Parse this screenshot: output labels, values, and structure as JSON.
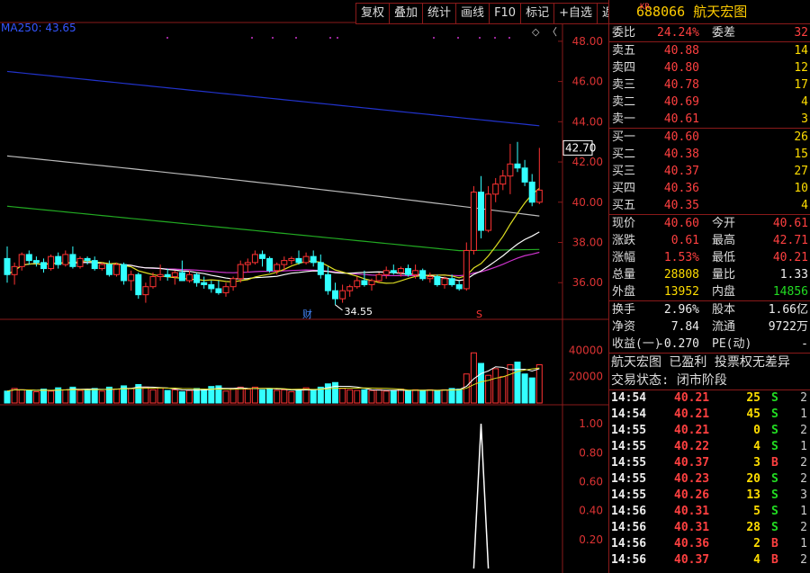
{
  "toolbar": {
    "buttons": [
      "复权",
      "叠加",
      "统计",
      "画线",
      "F10",
      "标记",
      "+自选",
      "返回"
    ]
  },
  "chart": {
    "ma_label": "MA250: 43.65",
    "price_axis": [
      "48.00",
      "46.00",
      "44.00",
      "42.00",
      "40.00",
      "38.00",
      "36.00"
    ],
    "current_price_tag": "42.70",
    "min_price_label": "34.55",
    "volume_axis": [
      "40000",
      "20000"
    ],
    "indicator_axis": [
      "1.00",
      "0.80",
      "0.60",
      "0.40",
      "0.20"
    ],
    "markers": {
      "cai": "财",
      "s": "S",
      "diamond": "◇",
      "chevron": "〈"
    }
  },
  "chart_data": {
    "type": "candlestick",
    "price_range": [
      34.4,
      48.8
    ],
    "candles": [
      [
        37.2,
        37.8,
        36.0,
        36.4
      ],
      [
        36.4,
        37.0,
        35.9,
        36.8
      ],
      [
        36.8,
        37.5,
        36.6,
        37.4
      ],
      [
        37.4,
        37.6,
        36.9,
        37.1
      ],
      [
        37.1,
        37.3,
        36.8,
        37.0
      ],
      [
        37.0,
        37.2,
        36.5,
        36.7
      ],
      [
        36.7,
        37.4,
        36.6,
        37.3
      ],
      [
        37.3,
        37.5,
        36.7,
        36.9
      ],
      [
        36.9,
        37.6,
        36.8,
        37.4
      ],
      [
        37.4,
        37.8,
        36.7,
        36.8
      ],
      [
        36.8,
        37.3,
        36.7,
        37.2
      ],
      [
        37.2,
        37.3,
        36.9,
        37.1
      ],
      [
        37.1,
        37.3,
        36.6,
        36.7
      ],
      [
        36.7,
        37.0,
        36.6,
        36.9
      ],
      [
        36.9,
        37.1,
        36.3,
        36.4
      ],
      [
        36.4,
        37.0,
        36.3,
        36.9
      ],
      [
        36.9,
        37.0,
        35.9,
        36.1
      ],
      [
        36.1,
        36.6,
        35.6,
        36.4
      ],
      [
        36.4,
        36.5,
        35.2,
        35.4
      ],
      [
        35.4,
        36.0,
        35.0,
        35.8
      ],
      [
        35.8,
        36.5,
        35.7,
        36.3
      ],
      [
        36.3,
        36.9,
        36.1,
        36.4
      ],
      [
        36.4,
        36.7,
        36.1,
        36.3
      ],
      [
        36.3,
        36.6,
        35.9,
        36.5
      ],
      [
        36.5,
        37.1,
        36.4,
        36.1
      ],
      [
        36.1,
        36.6,
        36.0,
        36.4
      ],
      [
        36.4,
        36.5,
        35.8,
        36.0
      ],
      [
        36.0,
        36.3,
        35.7,
        35.9
      ],
      [
        35.9,
        36.1,
        35.5,
        35.7
      ],
      [
        35.7,
        36.1,
        35.4,
        35.5
      ],
      [
        35.5,
        36.0,
        35.3,
        35.8
      ],
      [
        35.8,
        36.3,
        35.6,
        36.2
      ],
      [
        36.2,
        37.1,
        36.0,
        36.9
      ],
      [
        36.9,
        37.2,
        36.5,
        37.0
      ],
      [
        37.0,
        37.6,
        36.9,
        37.4
      ],
      [
        37.4,
        37.6,
        36.8,
        37.2
      ],
      [
        37.2,
        37.3,
        36.5,
        36.6
      ],
      [
        36.6,
        37.0,
        36.4,
        36.9
      ],
      [
        36.9,
        37.3,
        36.6,
        37.1
      ],
      [
        37.1,
        37.3,
        36.9,
        37.2
      ],
      [
        37.2,
        37.6,
        36.9,
        37.0
      ],
      [
        37.0,
        37.5,
        36.9,
        37.3
      ],
      [
        37.3,
        37.6,
        36.8,
        37.0
      ],
      [
        37.0,
        37.4,
        36.2,
        36.4
      ],
      [
        36.4,
        36.8,
        35.4,
        35.6
      ],
      [
        35.6,
        36.0,
        34.9,
        35.2
      ],
      [
        35.2,
        35.9,
        35.0,
        35.6
      ],
      [
        35.6,
        35.9,
        35.3,
        35.8
      ],
      [
        35.8,
        36.3,
        35.7,
        36.1
      ],
      [
        36.1,
        36.6,
        35.8,
        35.9
      ],
      [
        35.9,
        36.2,
        35.6,
        36.1
      ],
      [
        36.1,
        36.5,
        36.0,
        36.4
      ],
      [
        36.4,
        36.8,
        36.2,
        36.6
      ],
      [
        36.6,
        36.9,
        36.4,
        36.5
      ],
      [
        36.5,
        36.8,
        36.3,
        36.7
      ],
      [
        36.7,
        36.9,
        36.3,
        36.4
      ],
      [
        36.4,
        36.9,
        36.2,
        36.6
      ],
      [
        36.6,
        36.7,
        36.1,
        36.2
      ],
      [
        36.2,
        36.5,
        36.0,
        36.3
      ],
      [
        36.3,
        36.4,
        35.8,
        35.9
      ],
      [
        35.9,
        36.3,
        35.7,
        36.2
      ],
      [
        36.2,
        36.4,
        35.8,
        35.9
      ],
      [
        35.9,
        36.1,
        35.6,
        35.7
      ],
      [
        35.7,
        38.0,
        35.6,
        37.6
      ],
      [
        37.6,
        40.8,
        37.4,
        40.5
      ],
      [
        40.5,
        41.3,
        38.2,
        38.6
      ],
      [
        38.6,
        40.8,
        38.5,
        40.4
      ],
      [
        40.4,
        41.2,
        40.0,
        40.9
      ],
      [
        40.9,
        41.6,
        40.6,
        41.3
      ],
      [
        41.3,
        42.9,
        40.4,
        41.9
      ],
      [
        41.9,
        43.0,
        41.5,
        41.7
      ],
      [
        41.7,
        42.1,
        40.8,
        41.0
      ],
      [
        41.0,
        41.4,
        39.8,
        40.0
      ],
      [
        40.0,
        42.7,
        39.9,
        40.6
      ]
    ],
    "volume_range": [
      0,
      45000
    ],
    "volumes": [
      [
        9000,
        0
      ],
      [
        11000,
        1
      ],
      [
        10000,
        1
      ],
      [
        9500,
        0
      ],
      [
        8500,
        1
      ],
      [
        10500,
        0
      ],
      [
        9000,
        1
      ],
      [
        11500,
        0
      ],
      [
        10000,
        1
      ],
      [
        12000,
        0
      ],
      [
        9500,
        1
      ],
      [
        10000,
        0
      ],
      [
        11000,
        0
      ],
      [
        9000,
        1
      ],
      [
        12000,
        0
      ],
      [
        10500,
        1
      ],
      [
        13000,
        0
      ],
      [
        11000,
        1
      ],
      [
        14000,
        0
      ],
      [
        12000,
        1
      ],
      [
        10000,
        1
      ],
      [
        11500,
        1
      ],
      [
        9500,
        0
      ],
      [
        10000,
        1
      ],
      [
        8500,
        0
      ],
      [
        9500,
        1
      ],
      [
        11000,
        0
      ],
      [
        10000,
        0
      ],
      [
        12500,
        0
      ],
      [
        13000,
        0
      ],
      [
        9000,
        1
      ],
      [
        11000,
        1
      ],
      [
        12000,
        1
      ],
      [
        10500,
        1
      ],
      [
        12000,
        1
      ],
      [
        10000,
        0
      ],
      [
        11000,
        0
      ],
      [
        9500,
        1
      ],
      [
        10000,
        1
      ],
      [
        8500,
        1
      ],
      [
        10000,
        0
      ],
      [
        11500,
        1
      ],
      [
        10000,
        0
      ],
      [
        12000,
        0
      ],
      [
        14500,
        0
      ],
      [
        15500,
        0
      ],
      [
        11000,
        1
      ],
      [
        10000,
        1
      ],
      [
        9500,
        1
      ],
      [
        10000,
        0
      ],
      [
        9500,
        1
      ],
      [
        10000,
        1
      ],
      [
        9000,
        1
      ],
      [
        9500,
        0
      ],
      [
        10500,
        1
      ],
      [
        9000,
        0
      ],
      [
        10000,
        1
      ],
      [
        9500,
        0
      ],
      [
        10000,
        1
      ],
      [
        9500,
        0
      ],
      [
        10000,
        1
      ],
      [
        11000,
        0
      ],
      [
        10500,
        0
      ],
      [
        22000,
        1
      ],
      [
        38000,
        1
      ],
      [
        30000,
        0
      ],
      [
        21000,
        1
      ],
      [
        26000,
        1
      ],
      [
        20000,
        1
      ],
      [
        29000,
        1
      ],
      [
        31000,
        0
      ],
      [
        22000,
        0
      ],
      [
        19000,
        0
      ],
      [
        29000,
        1
      ]
    ],
    "indicator_range": [
      0,
      1.1
    ],
    "indicator_spike": {
      "index": 65,
      "value": 1.0
    }
  },
  "quote": {
    "code": "688066",
    "name": "航天宏图",
    "prefix": "KR",
    "wei_bi_label": "委比",
    "wei_bi": "24.24%",
    "wei_cha_label": "委差",
    "wei_cha": "32",
    "asks": [
      {
        "label": "卖五",
        "price": "40.88",
        "vol": "14"
      },
      {
        "label": "卖四",
        "price": "40.80",
        "vol": "12"
      },
      {
        "label": "卖三",
        "price": "40.78",
        "vol": "17"
      },
      {
        "label": "卖二",
        "price": "40.69",
        "vol": "4"
      },
      {
        "label": "卖一",
        "price": "40.61",
        "vol": "3"
      }
    ],
    "bids": [
      {
        "label": "买一",
        "price": "40.60",
        "vol": "26"
      },
      {
        "label": "买二",
        "price": "40.38",
        "vol": "15"
      },
      {
        "label": "买三",
        "price": "40.37",
        "vol": "27"
      },
      {
        "label": "买四",
        "price": "40.36",
        "vol": "10"
      },
      {
        "label": "买五",
        "price": "40.35",
        "vol": "4"
      }
    ],
    "stats": [
      {
        "l1": "现价",
        "v1": "40.60",
        "l2": "今开",
        "v2": "40.61"
      },
      {
        "l1": "涨跌",
        "v1": "0.61",
        "l2": "最高",
        "v2": "42.71"
      },
      {
        "l1": "涨幅",
        "v1": "1.53%",
        "l2": "最低",
        "v2": "40.21"
      },
      {
        "l1": "总量",
        "v1": "28808",
        "l2": "量比",
        "v2": "1.33"
      },
      {
        "l1": "外盘",
        "v1": "13952",
        "l2": "内盘",
        "v2": "14856"
      }
    ],
    "stats2": [
      {
        "l1": "换手",
        "v1": "2.96%",
        "l2": "股本",
        "v2": "1.66亿"
      },
      {
        "l1": "净资",
        "v1": "7.84",
        "l2": "流通",
        "v2": "9722万"
      },
      {
        "l1": "收益(一)",
        "v1": "-0.270",
        "l2": "PE(动)",
        "v2": "-"
      }
    ],
    "info1": "航天宏图 已盈利 投票权无差异",
    "info2": "交易状态: 闭市阶段"
  },
  "trades": [
    {
      "time": "14:54",
      "price": "40.21",
      "vol": "25",
      "bs": "S",
      "n": "2"
    },
    {
      "time": "14:54",
      "price": "40.21",
      "vol": "45",
      "bs": "S",
      "n": "1"
    },
    {
      "time": "14:55",
      "price": "40.21",
      "vol": "0",
      "bs": "S",
      "n": "2"
    },
    {
      "time": "14:55",
      "price": "40.22",
      "vol": "4",
      "bs": "S",
      "n": "1"
    },
    {
      "time": "14:55",
      "price": "40.37",
      "vol": "3",
      "bs": "B",
      "n": "2"
    },
    {
      "time": "14:55",
      "price": "40.23",
      "vol": "20",
      "bs": "S",
      "n": "2"
    },
    {
      "time": "14:55",
      "price": "40.26",
      "vol": "13",
      "bs": "S",
      "n": "3"
    },
    {
      "time": "14:56",
      "price": "40.31",
      "vol": "5",
      "bs": "S",
      "n": "1"
    },
    {
      "time": "14:56",
      "price": "40.31",
      "vol": "28",
      "bs": "S",
      "n": "2"
    },
    {
      "time": "14:56",
      "price": "40.36",
      "vol": "2",
      "bs": "B",
      "n": "1"
    },
    {
      "time": "14:56",
      "price": "40.37",
      "vol": "4",
      "bs": "B",
      "n": "2"
    }
  ]
}
